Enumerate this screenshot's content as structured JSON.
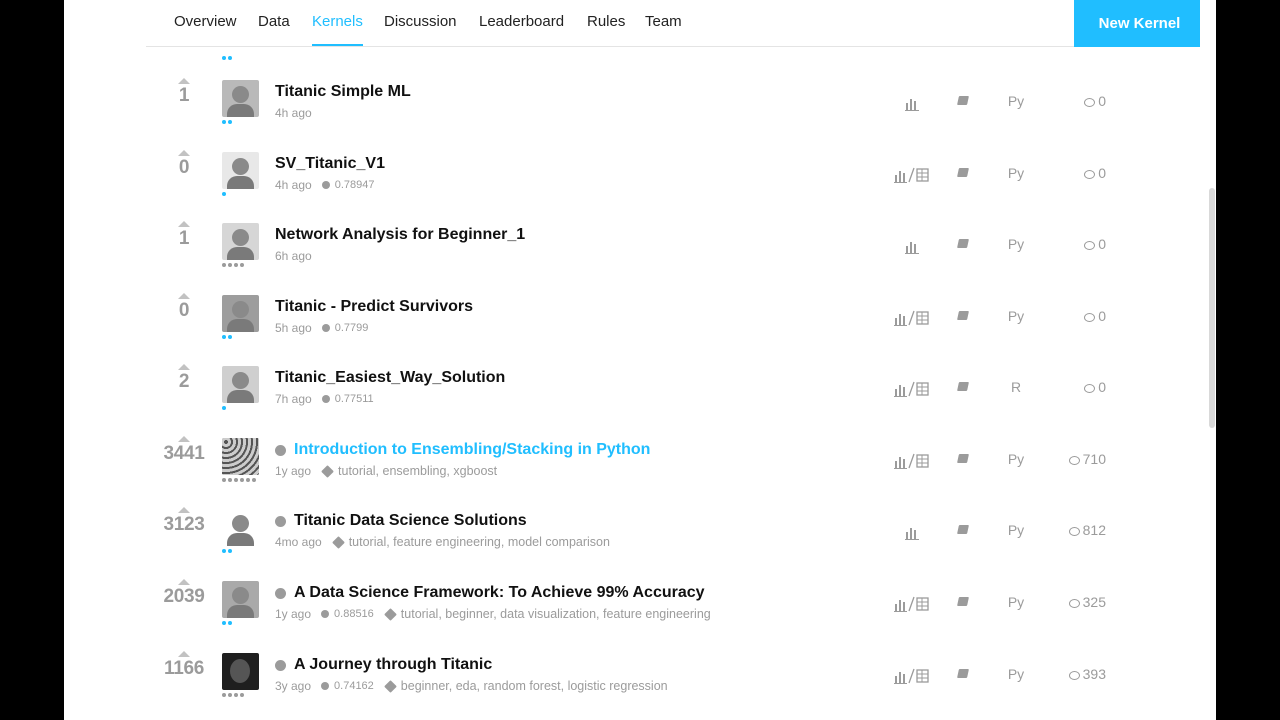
{
  "nav": {
    "tabs": [
      "Overview",
      "Data",
      "Kernels",
      "Discussion",
      "Leaderboard",
      "Rules",
      "Team"
    ],
    "active_tab": "Kernels",
    "new_kernel_label": "New Kernel"
  },
  "kernels": [
    {
      "votes": "1",
      "title": "Titanic Simple ML",
      "age": "4h ago",
      "score": "",
      "tags": "",
      "output": "chart",
      "lang": "Py",
      "comments": "0",
      "medal": false,
      "link": false
    },
    {
      "votes": "0",
      "title": "SV_Titanic_V1",
      "age": "4h ago",
      "score": "0.78947",
      "tags": "",
      "output": "chart-table",
      "lang": "Py",
      "comments": "0",
      "medal": false,
      "link": false
    },
    {
      "votes": "1",
      "title": "Network Analysis for Beginner_1",
      "age": "6h ago",
      "score": "",
      "tags": "",
      "output": "chart",
      "lang": "Py",
      "comments": "0",
      "medal": false,
      "link": false
    },
    {
      "votes": "0",
      "title": "Titanic - Predict Survivors",
      "age": "5h ago",
      "score": "0.7799",
      "tags": "",
      "output": "chart-table",
      "lang": "Py",
      "comments": "0",
      "medal": false,
      "link": false
    },
    {
      "votes": "2",
      "title": "Titanic_Easiest_Way_Solution",
      "age": "7h ago",
      "score": "0.77511",
      "tags": "",
      "output": "chart-table",
      "lang": "R",
      "comments": "0",
      "medal": false,
      "link": false
    },
    {
      "votes": "3441",
      "title": "Introduction to Ensembling/Stacking in Python",
      "age": "1y ago",
      "score": "",
      "tags": "tutorial, ensembling, xgboost",
      "output": "chart-table",
      "lang": "Py",
      "comments": "710",
      "medal": true,
      "link": true
    },
    {
      "votes": "3123",
      "title": "Titanic Data Science Solutions",
      "age": "4mo ago",
      "score": "",
      "tags": "tutorial, feature engineering, model comparison",
      "output": "chart",
      "lang": "Py",
      "comments": "812",
      "medal": true,
      "link": false
    },
    {
      "votes": "2039",
      "title": "A Data Science Framework: To Achieve 99% Accuracy",
      "age": "1y ago",
      "score": "0.88516",
      "tags": "tutorial, beginner, data visualization, feature engineering",
      "output": "chart-table",
      "lang": "Py",
      "comments": "325",
      "medal": true,
      "link": false
    },
    {
      "votes": "1166",
      "title": "A Journey through Titanic",
      "age": "3y ago",
      "score": "0.74162",
      "tags": "beginner, eda, random forest, logistic regression",
      "output": "chart-table",
      "lang": "Py",
      "comments": "393",
      "medal": true,
      "link": false
    }
  ]
}
